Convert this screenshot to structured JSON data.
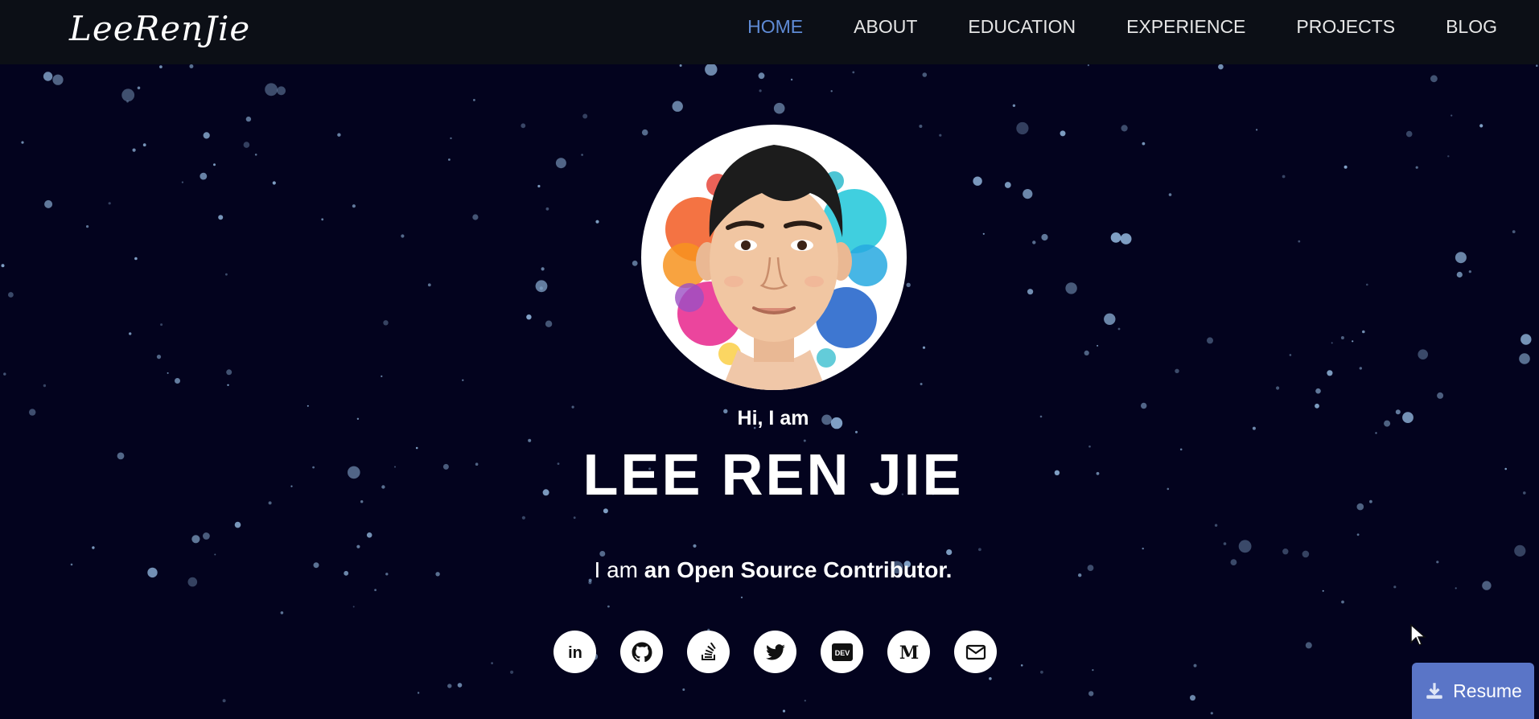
{
  "brand": {
    "logo_text": "LeeRenJie"
  },
  "nav": {
    "items": [
      "HOME",
      "ABOUT",
      "EDUCATION",
      "EXPERIENCE",
      "PROJECTS",
      "BLOG"
    ],
    "active": "HOME"
  },
  "hero": {
    "greeting": "Hi, I am",
    "name": "LEE REN JIE",
    "tagline_prefix": "I am",
    "tagline_highlight": "an Open Source Contributor."
  },
  "socials": [
    {
      "name": "linkedin-icon",
      "label": "in"
    },
    {
      "name": "github-icon"
    },
    {
      "name": "stackoverflow-icon"
    },
    {
      "name": "twitter-icon"
    },
    {
      "name": "dev-icon",
      "label": "DEV"
    },
    {
      "name": "medium-icon",
      "label": "M"
    },
    {
      "name": "email-icon"
    }
  ],
  "resume": {
    "label": "Resume"
  },
  "colors": {
    "background": "#03031e",
    "navbar": "#0c0f16",
    "active_link": "#5f8bd6",
    "particle": "#8fb3d9",
    "resume_button": "#5a75c7"
  }
}
